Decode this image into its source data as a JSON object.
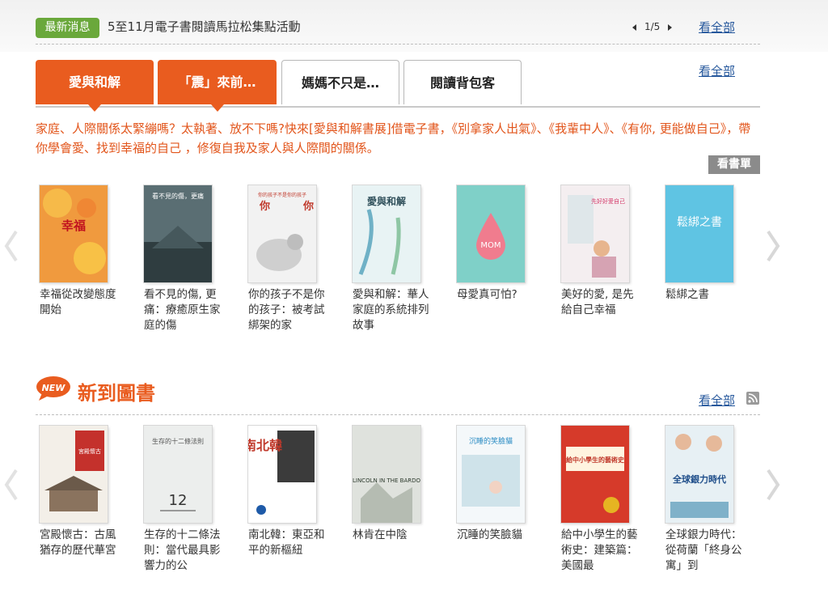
{
  "news": {
    "badge": "最新消息",
    "headline": "5至11月電子書閱讀馬拉松集點活動",
    "pager": "1/5",
    "see_all": "看全部"
  },
  "tabs": [
    {
      "label": "愛與和解",
      "active": true
    },
    {
      "label": "「震」來前…",
      "active": true
    },
    {
      "label": "媽媽不只是…",
      "active": false
    },
    {
      "label": "閱讀背包客",
      "active": false
    }
  ],
  "tabs_see_all": "看全部",
  "promo_text": "家庭、人際關係太緊繃嗎？太執著、放不下嗎?快來[愛與和解書展]借電子書，《別拿家人出氣》、《我輩中人》、《有你, 更能做自己》，帶你學會愛、找到幸福的自己 ，修復自我及家人與人際間的關係。",
  "list_button": "看書單",
  "featured_books": [
    {
      "title": "幸福從改變態度開始",
      "cover_text": "幸福",
      "cover_color": "#f09a3e"
    },
    {
      "title": "看不見的傷, 更痛：療癒原生家庭的傷",
      "cover_text": "看不見的傷，更痛",
      "cover_color": "#5a6e73"
    },
    {
      "title": "你的孩子不是你的孩子：被考試綁架的家",
      "cover_text": "你的孩子不是你的孩子",
      "cover_color": "#f2f2f2"
    },
    {
      "title": "愛與和解：華人家庭的系統排列故事",
      "cover_text": "愛與和解",
      "cover_color": "#e8f3f4"
    },
    {
      "title": "母愛真可怕?",
      "cover_text": "MOM",
      "cover_color": "#7fd0c8"
    },
    {
      "title": "美好的愛, 是先給自己幸福",
      "cover_text": "先好好愛自己",
      "cover_color": "#f4eef0"
    },
    {
      "title": "鬆綁之書",
      "cover_text": "鬆綁之書",
      "cover_color": "#5fc4e3"
    }
  ],
  "new_section": {
    "logo_text": "NEW",
    "title": "新到圖書",
    "see_all": "看全部"
  },
  "new_books": [
    {
      "title": "宮殿懷古：古風猶存的歷代華宮",
      "cover_text": "宮殿懷古",
      "cover_color": "#c4312c"
    },
    {
      "title": "生存的十二條法則：當代最具影響力的公",
      "cover_text": "生存的十二條法則",
      "cover_color": "#eceeed"
    },
    {
      "title": "南北韓：東亞和平的新樞紐",
      "cover_text": "南北韓",
      "cover_color": "#ffffff"
    },
    {
      "title": "林肯在中陰",
      "cover_text": "LINCOLN IN THE BARDO",
      "cover_color": "#dfe2dd"
    },
    {
      "title": "沉睡的笑臉貓",
      "cover_text": "沉睡的笑臉貓",
      "cover_color": "#f4f8fa"
    },
    {
      "title": "給中小學生的藝術史：建築篇：美國最",
      "cover_text": "給中小學生的藝術史",
      "cover_color": "#d63a2a"
    },
    {
      "title": "全球銀力時代：從荷蘭「終身公寓」到",
      "cover_text": "全球銀力時代",
      "cover_color": "#e7f0f4"
    }
  ],
  "colors": {
    "accent": "#e95c1f",
    "news_badge": "#6aa83b",
    "link": "#25579c",
    "list_button": "#8b8b8b"
  }
}
